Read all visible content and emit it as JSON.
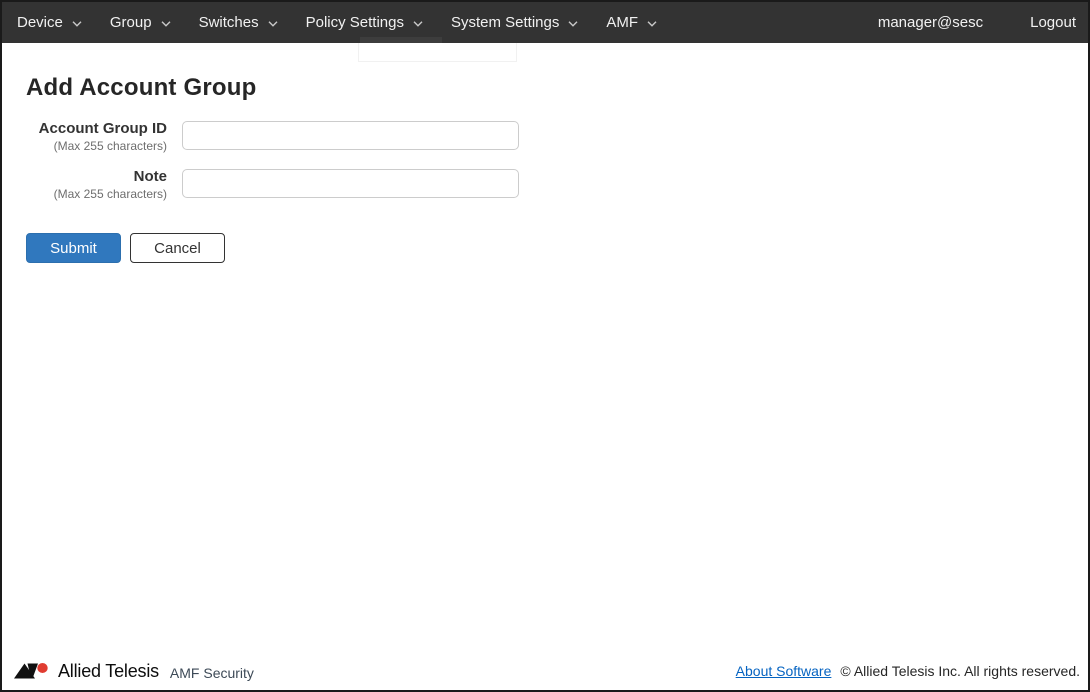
{
  "colors": {
    "nav_background": "#333333",
    "nav_text": "#f1f1f1",
    "accent_blue": "#3078be",
    "link_blue": "#0563c1",
    "logo_red": "#e03c31",
    "input_border": "#cccccc"
  },
  "navbar": {
    "items": [
      {
        "label": "Device"
      },
      {
        "label": "Group"
      },
      {
        "label": "Switches"
      },
      {
        "label": "Policy Settings"
      },
      {
        "label": "System Settings"
      },
      {
        "label": "AMF"
      }
    ],
    "user": "manager@sesc",
    "logout_label": "Logout"
  },
  "main": {
    "title": "Add Account Group",
    "fields": [
      {
        "label": "Account Group ID",
        "hint": "(Max 255 characters)",
        "value": "",
        "placeholder": ""
      },
      {
        "label": "Note",
        "hint": "(Max 255 characters)",
        "value": "",
        "placeholder": ""
      }
    ],
    "submit_label": "Submit",
    "cancel_label": "Cancel"
  },
  "footer": {
    "brand": "Allied Telesis",
    "product": "AMF Security",
    "about_link": "About Software",
    "copyright": "© Allied Telesis Inc. All rights reserved."
  }
}
